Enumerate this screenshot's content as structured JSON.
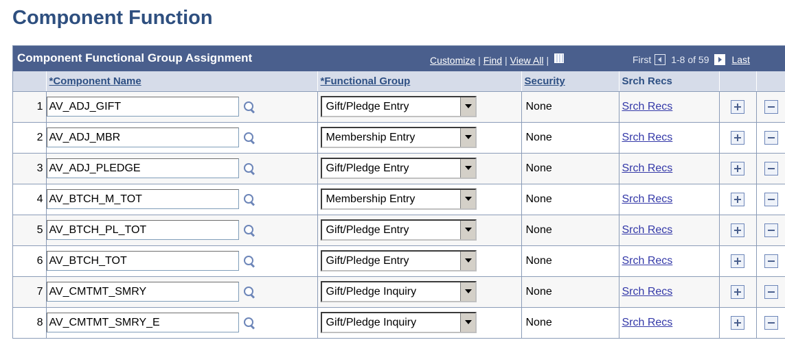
{
  "page_title": "Component Function",
  "grid": {
    "title": "Component Functional Group Assignment",
    "links": {
      "customize": "Customize",
      "find": "Find",
      "view_all": "View All",
      "sep": "|"
    },
    "nav": {
      "first": "First",
      "range": "1-8 of 59",
      "last": "Last"
    },
    "columns": {
      "component_name": "*Component Name",
      "functional_group": "*Functional Group",
      "security": "Security",
      "srch_recs": "Srch Recs"
    },
    "rows": [
      {
        "num": "1",
        "component": "AV_ADJ_GIFT",
        "group": "Gift/Pledge Entry",
        "security": "None",
        "link": "Srch Recs"
      },
      {
        "num": "2",
        "component": "AV_ADJ_MBR",
        "group": "Membership Entry",
        "security": "None",
        "link": "Srch Recs"
      },
      {
        "num": "3",
        "component": "AV_ADJ_PLEDGE",
        "group": "Gift/Pledge Entry",
        "security": "None",
        "link": "Srch Recs"
      },
      {
        "num": "4",
        "component": "AV_BTCH_M_TOT",
        "group": "Membership Entry",
        "security": "None",
        "link": "Srch Recs"
      },
      {
        "num": "5",
        "component": "AV_BTCH_PL_TOT",
        "group": "Gift/Pledge Entry",
        "security": "None",
        "link": "Srch Recs"
      },
      {
        "num": "6",
        "component": "AV_BTCH_TOT",
        "group": "Gift/Pledge Entry",
        "security": "None",
        "link": "Srch Recs"
      },
      {
        "num": "7",
        "component": "AV_CMTMT_SMRY",
        "group": "Gift/Pledge Inquiry",
        "security": "None",
        "link": "Srch Recs"
      },
      {
        "num": "8",
        "component": "AV_CMTMT_SMRY_E",
        "group": "Gift/Pledge Inquiry",
        "security": "None",
        "link": "Srch Recs"
      }
    ]
  },
  "colors": {
    "title": "#2e4f7f",
    "header_bar": "#4a5f8d",
    "col_header": "#d6dce9",
    "link": "#3338a8"
  }
}
